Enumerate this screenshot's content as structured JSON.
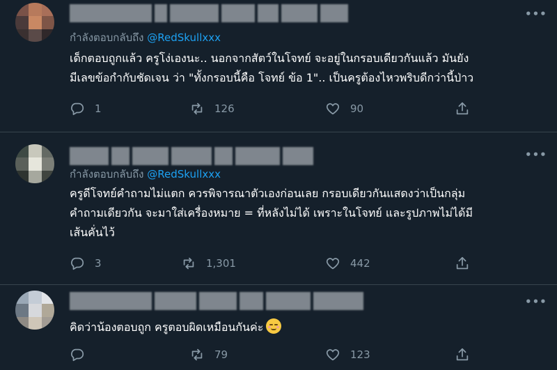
{
  "theme": {
    "background": "#15202b",
    "divider": "#38444d",
    "text": "#ffffff",
    "muted": "#8899a6",
    "link": "#1da1f2"
  },
  "icons": {
    "more": "more-horizontal-icon",
    "reply": "reply-icon",
    "retweet": "retweet-icon",
    "like": "heart-icon",
    "share": "share-icon",
    "emoji": "relieved-face-emoji"
  },
  "tweets": [
    {
      "avatar_colors": [
        "#7a5248",
        "#b77a5c",
        "#a96f59",
        "#4a3a3a",
        "#c98863",
        "#7e5547",
        "#3a3030",
        "#5a4a48",
        "#30282a"
      ],
      "replying_prefix": "กำลังตอบกลับถึง",
      "replying_handle": "@RedSkullxxx",
      "text_lines": [
        "เด็กตอบถูกแล้ว ครูโง่เองนะ.. นอกจากสัตว์ในโจทย์ จะอยู่ในกรอบเดียวกันแล้ว มันยัง",
        "มีเลขข้อกำกับชัดเจน ว่า \"ทั้งกรอบนี้คือ โจทย์ ข้อ 1\".. เป็นครูต้องไหวพริบดีกว่านี้ป่าว"
      ],
      "replies": "1",
      "retweets": "126",
      "likes": "90"
    },
    {
      "avatar_colors": [
        "#3e4a44",
        "#c8c8bc",
        "#646a64",
        "#5a605a",
        "#e6e6dc",
        "#7c7f78",
        "#2e3430",
        "#a6a89e",
        "#40453f"
      ],
      "replying_prefix": "กำลังตอบกลับถึง",
      "replying_handle": "@RedSkullxxx",
      "text_lines": [
        "ครูดีโจทย์คำถามไม่แตก ควรพิจารณาตัวเองก่อนเลย กรอบเดียวกันแสดงว่าเป็นกลุ่ม",
        "คำถามเดียวกัน จะมาใส่เครื่องหมาย = ที่หลังไม่ได้ เพราะในโจทย์ และรูปภาพไม่ได้มี",
        "เส้นคั่นไว้"
      ],
      "replies": "3",
      "retweets": "1,301",
      "likes": "442"
    },
    {
      "avatar_colors": [
        "#9aa8b6",
        "#c4ccd6",
        "#e2e4e8",
        "#6c7884",
        "#d6d8dc",
        "#b0a898",
        "#8e8a84",
        "#cfc6b8",
        "#a29c94"
      ],
      "text_lines": [
        "คิดว่าน้องตอบถูก ครูตอบผิดเหมือนกันค่ะ"
      ],
      "replies": "",
      "retweets": "79",
      "likes": "123"
    }
  ]
}
